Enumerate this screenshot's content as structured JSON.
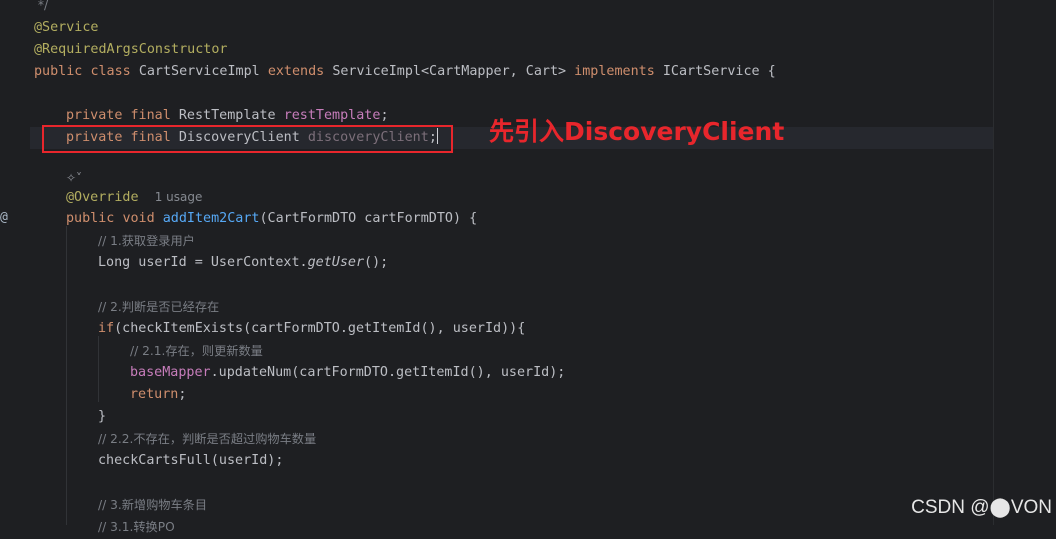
{
  "code": {
    "l0": " */",
    "l1_ann": "@Service",
    "l2_ann": "@RequiredArgsConstructor",
    "l3": {
      "kw1": "public",
      "kw2": "class",
      "name": "CartServiceImpl",
      "kw3": "extends",
      "base": "ServiceImpl<CartMapper, Cart>",
      "kw4": "implements",
      "iface": "ICartService {"
    },
    "l5": {
      "kw1": "private",
      "kw2": "final",
      "type": "RestTemplate",
      "field": "restTemplate",
      "end": ";"
    },
    "l6": {
      "kw1": "private",
      "kw2": "final",
      "type": "DiscoveryClient",
      "field": "discoveryClient",
      "end": ";"
    },
    "l8_ann": "@Override",
    "l8_hint": "1 usage",
    "l9": {
      "kw1": "public",
      "kw2": "void",
      "method": "addItem2Cart",
      "params": "(CartFormDTO cartFormDTO) {"
    },
    "l10_comment": "// 1.获取登录用户",
    "l11": {
      "pre": "Long userId = UserContext.",
      "call": "getUser",
      "post": "();"
    },
    "l13_comment": "// 2.判断是否已经存在",
    "l14": {
      "kw": "if",
      "rest": "(checkItemExists(cartFormDTO.getItemId(), userId)){"
    },
    "l15_comment": "// 2.1.存在，则更新数量",
    "l16": {
      "field": "baseMapper",
      "rest": ".updateNum(cartFormDTO.getItemId(), userId);"
    },
    "l17": {
      "kw": "return",
      "end": ";"
    },
    "l18": "}",
    "l19_comment": "// 2.2.不存在，判断是否超过购物车数量",
    "l20": "checkCartsFull(userId);",
    "l22_comment": "// 3.新增购物车条目",
    "l23_comment": "// 3.1.转换PO"
  },
  "annotation": {
    "callout_text": "先引入DiscoveryClient",
    "highlight_color": "#e8262c"
  },
  "ai_icon": "sparkle-icon",
  "gutter_marker": "@",
  "watermark": "CSDN @⬤VON"
}
